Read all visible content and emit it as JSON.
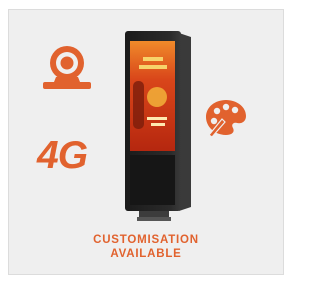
{
  "feature": {
    "network_label": "4G",
    "caption_line1": "CUSTOMISATION",
    "caption_line2": "AVAILABLE",
    "accent_color": "#e1622e"
  },
  "icons": {
    "left_top": "webcam-icon",
    "right": "paint-palette-icon",
    "center": "outdoor-digital-kiosk"
  }
}
